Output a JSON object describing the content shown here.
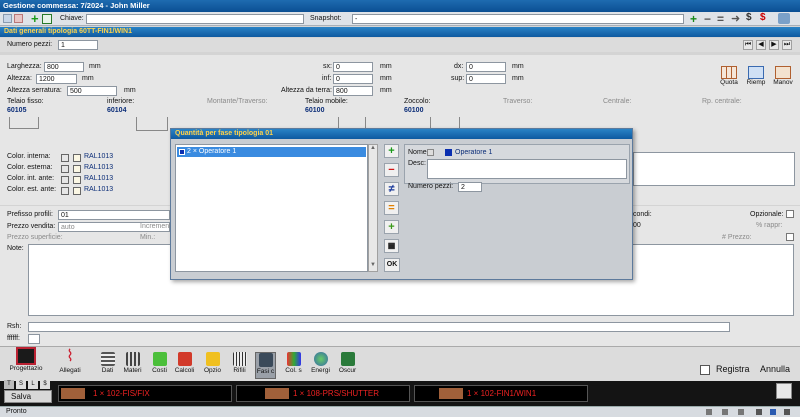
{
  "window": {
    "title": "Gestione commessa: 7/2024 - John Miller"
  },
  "toolbar": {
    "chiave_label": "Chiave:",
    "chiave_value": "",
    "snapshot_label": "Snapshot:",
    "snapshot_value": "-"
  },
  "section": {
    "title": "Dati generali tipologia 60TT-FIN1/WIN1"
  },
  "numero_pezzi": {
    "label": "Numero pezzi:",
    "value": "1"
  },
  "dims": {
    "larghezza_label": "Larghezza:",
    "larghezza_value": "800",
    "larghezza_unit": "mm",
    "altezza_label": "Altezza:",
    "altezza_value": "1200",
    "altezza_unit": "mm",
    "altezza_serr_label": "Altezza serratura:",
    "altezza_serr_value": "500",
    "altezza_serr_unit": "mm",
    "sx_label": "sx:",
    "sx_value": "0",
    "sx_unit": "mm",
    "inf_label": "inf:",
    "inf_value": "0",
    "inf_unit": "mm",
    "alt_terra_label": "Altezza da terra:",
    "alt_terra_value": "800",
    "alt_terra_unit": "mm",
    "dx_label": "dx:",
    "dx_value": "0",
    "dx_unit": "mm",
    "sup_label": "sup:",
    "sup_value": "0",
    "sup_unit": "mm"
  },
  "right_buttons": {
    "quota": "Quota",
    "riemp": "Riemp",
    "manov": "Manov"
  },
  "profiles": {
    "telaio_fisso_label": "Telaio fisso:",
    "telaio_fisso_value": "60105",
    "inferiore_label": "inferiore:",
    "inferiore_value": "60104",
    "montante_label": "Montante/Traverso:",
    "telaio_mobile_label": "Telaio mobile:",
    "telaio_mobile_value": "60100",
    "zoccolo_label": "Zoccolo:",
    "zoccolo_value": "60100",
    "traverso_label": "Traverso:",
    "centrale_label": "Centrale:",
    "rp_centrale_label": "Rp. centrale:"
  },
  "colors": [
    {
      "label": "Color. interna:",
      "value": "RAL1013"
    },
    {
      "label": "Color. esterna:",
      "value": "RAL1013"
    },
    {
      "label": "Color. int. ante:",
      "value": "RAL1013"
    },
    {
      "label": "Color. est. ante:",
      "value": "RAL1013"
    }
  ],
  "lower": {
    "prefisso_label": "Prefisso profili:",
    "prefisso_value": "01",
    "prezzo_vendita_label": "Prezzo vendita:",
    "prezzo_vendita_value": "auto",
    "incremento_label": "Increment",
    "prezzo_superficie_label": "Prezzo superficie:",
    "min_label": "Min.:",
    "note_label": "Note:",
    "condi_label": "condi:",
    "opzionale_label": "Opzionale:",
    "rappr_label": "% rappr:",
    "prezzo_pct_label": "# Prezzo:",
    "condi_value": "00",
    "rsh_label": "Rsh:",
    "ffff_label": "ffffff:"
  },
  "dialog": {
    "title": "Quantità per fase tipologia 01",
    "list_items": [
      "2 × Operatore 1"
    ],
    "nome_label": "Nome:",
    "nome_value": "Operatore 1",
    "desc_label": "Desc:",
    "desc_value": "",
    "numero_pezzi_label": "Numero pezzi:",
    "numero_pezzi_value": "2",
    "ok_label": "OK"
  },
  "bottom_toolbar": {
    "progettazio": "Progettazio",
    "allegati": "Allegati",
    "dati": "Dati",
    "materi": "Materi",
    "costi": "Costi",
    "calcoli": "Calcoli",
    "opzio": "Opzio",
    "rifili": "Rifili",
    "fasi": "Fasi c",
    "col_s": "Col. s",
    "energi": "Energi",
    "oscur": "Oscur",
    "registra": "Registra",
    "annulla": "Annulla"
  },
  "mode_buttons": [
    "T",
    "S",
    "L",
    "$"
  ],
  "salva_label": "Salva",
  "tabs": [
    {
      "label": "1 × 102-FIS/FIX"
    },
    {
      "label": "1 × 108-PRS/SHUTTER"
    },
    {
      "label": "1 × 102-FIN1/WIN1"
    }
  ],
  "status": {
    "text": "Pronto"
  },
  "accent": {
    "title_blue": "#0e5aa0",
    "header_yellow": "#ffd24a",
    "tab_red": "#e22222",
    "swatch_brown": "#a0603a",
    "select_blue": "#3a8be0"
  }
}
